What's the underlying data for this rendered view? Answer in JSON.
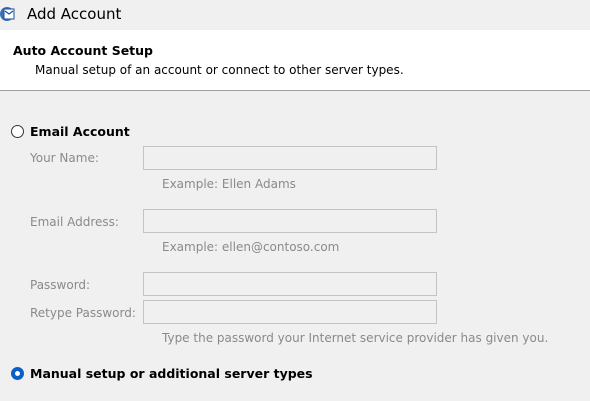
{
  "window": {
    "title": "Add Account",
    "icon": "outlook-app-icon"
  },
  "header": {
    "title": "Auto Account Setup",
    "subtitle": "Manual setup of an account or connect to other server types."
  },
  "email_account": {
    "label": "Email Account",
    "selected": false,
    "enabled": false,
    "fields": {
      "your_name": {
        "label": "Your Name:",
        "value": "",
        "hint": "Example: Ellen Adams"
      },
      "email_address": {
        "label": "Email Address:",
        "value": "",
        "hint": "Example: ellen@contoso.com"
      },
      "password": {
        "label": "Password:",
        "value": ""
      },
      "retype_password": {
        "label": "Retype Password:",
        "value": "",
        "hint": "Type the password your Internet service provider has given you."
      }
    }
  },
  "manual_setup": {
    "label": "Manual setup or additional server types",
    "selected": true
  },
  "colors": {
    "background": "#f0f0f0",
    "header_background": "#ffffff",
    "radio_selected": "#0a5fc7",
    "disabled_text": "#8a8a8a",
    "disabled_border": "#c4c4c4"
  }
}
